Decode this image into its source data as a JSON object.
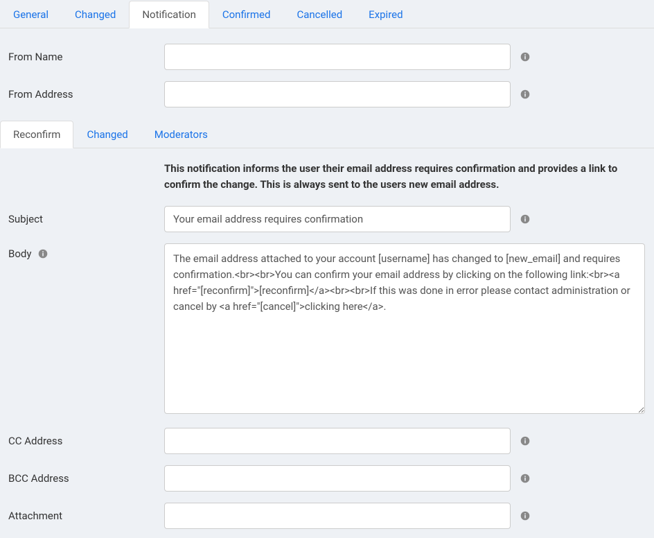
{
  "mainTabs": {
    "general": "General",
    "changed": "Changed",
    "notification": "Notification",
    "confirmed": "Confirmed",
    "cancelled": "Cancelled",
    "expired": "Expired"
  },
  "fields": {
    "fromName": {
      "label": "From Name",
      "value": ""
    },
    "fromAddress": {
      "label": "From Address",
      "value": ""
    },
    "subject": {
      "label": "Subject",
      "value": "Your email address requires confirmation"
    },
    "body": {
      "label": "Body",
      "value": "The email address attached to your account [username] has changed to [new_email] and requires confirmation.<br><br>You can confirm your email address by clicking on the following link:<br><a href=\"[reconfirm]\">[reconfirm]</a><br><br>If this was done in error please contact administration or cancel by <a href=\"[cancel]\">clicking here</a>."
    },
    "ccAddress": {
      "label": "CC Address",
      "value": ""
    },
    "bccAddress": {
      "label": "BCC Address",
      "value": ""
    },
    "attachment": {
      "label": "Attachment",
      "value": ""
    }
  },
  "subTabs": {
    "reconfirm": "Reconfirm",
    "changed": "Changed",
    "moderators": "Moderators"
  },
  "description": "This notification informs the user their email address requires confirmation and provides a link to confirm the change. This is always sent to the users new email address."
}
